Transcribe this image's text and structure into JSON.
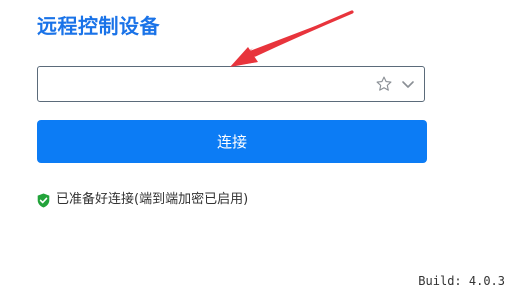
{
  "header": {
    "title": "远程控制设备"
  },
  "id_field": {
    "value": "",
    "placeholder": "",
    "favorite_icon": "star-icon",
    "dropdown_icon": "chevron-down-icon"
  },
  "connect_button": {
    "label": "连接"
  },
  "status": {
    "icon": "shield-check-icon",
    "text": "已准备好连接(端到端加密已启用)"
  },
  "footer": {
    "build": "Build: 4.0.3"
  },
  "colors": {
    "accent": "#1a73e8",
    "button": "#0c7cf5",
    "annotation_arrow": "#e8343c",
    "status_ok": "#22a33a"
  }
}
